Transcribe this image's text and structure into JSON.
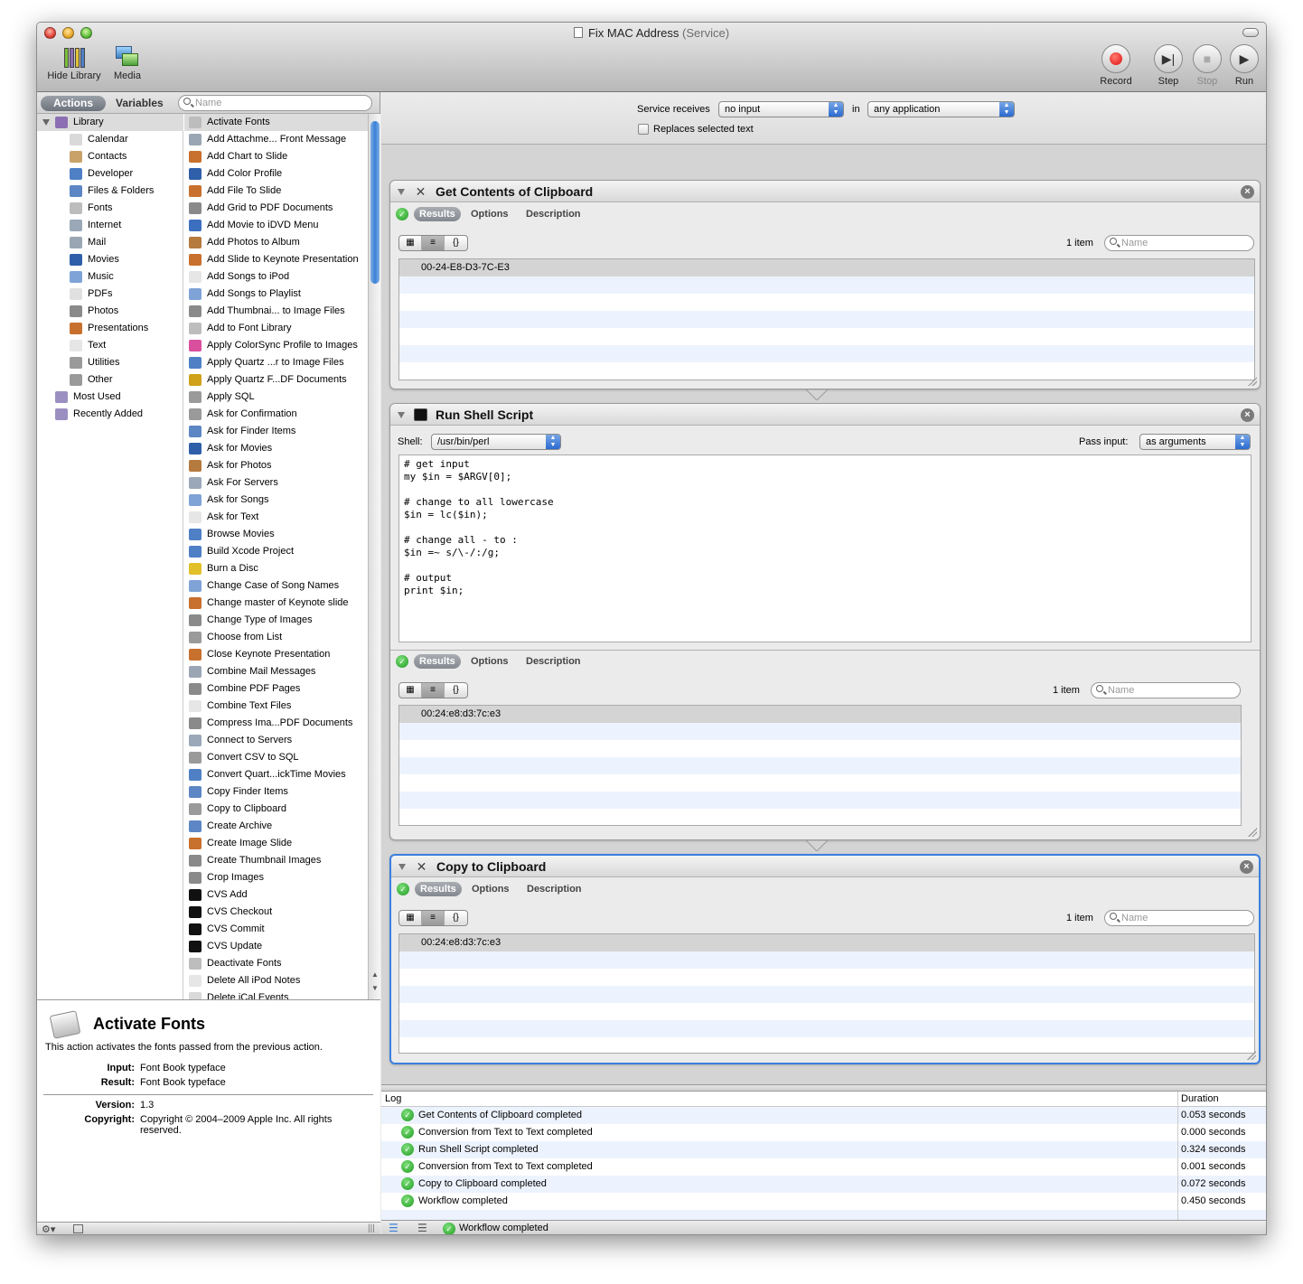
{
  "window": {
    "title": "Fix MAC Address",
    "subtitle": "(Service)"
  },
  "toolbar": {
    "hide_library": "Hide Library",
    "media": "Media",
    "record": "Record",
    "step": "Step",
    "stop": "Stop",
    "run": "Run"
  },
  "library": {
    "tab_actions": "Actions",
    "tab_variables": "Variables",
    "search_placeholder": "Name",
    "tree": [
      {
        "label": "Library",
        "icon": "library-icon",
        "color": "#8c6fb3"
      },
      {
        "label": "Calendar",
        "icon": "calendar-icon",
        "color": "#d9d9d9"
      },
      {
        "label": "Contacts",
        "icon": "contacts-icon",
        "color": "#c8a269"
      },
      {
        "label": "Developer",
        "icon": "developer-icon",
        "color": "#4f80c6"
      },
      {
        "label": "Files & Folders",
        "icon": "finder-icon",
        "color": "#5c86c4"
      },
      {
        "label": "Fonts",
        "icon": "fonts-icon",
        "color": "#bdbdbd"
      },
      {
        "label": "Internet",
        "icon": "internet-icon",
        "color": "#9aa8b8"
      },
      {
        "label": "Mail",
        "icon": "mail-icon",
        "color": "#9aa6b4"
      },
      {
        "label": "Movies",
        "icon": "movies-icon",
        "color": "#2f5fa8"
      },
      {
        "label": "Music",
        "icon": "music-icon",
        "color": "#7fa3d6"
      },
      {
        "label": "PDFs",
        "icon": "pdf-icon",
        "color": "#e0e0e0"
      },
      {
        "label": "Photos",
        "icon": "photos-icon",
        "color": "#8a8a8a"
      },
      {
        "label": "Presentations",
        "icon": "presentations-icon",
        "color": "#c8702e"
      },
      {
        "label": "Text",
        "icon": "text-icon",
        "color": "#e6e6e6"
      },
      {
        "label": "Utilities",
        "icon": "utilities-icon",
        "color": "#9a9a9a"
      },
      {
        "label": "Other",
        "icon": "other-icon",
        "color": "#9a9a9a"
      },
      {
        "label": "Most Used",
        "icon": "most-used-folder-icon",
        "color": "#9b8fc2"
      },
      {
        "label": "Recently Added",
        "icon": "recently-added-folder-icon",
        "color": "#9b8fc2"
      }
    ],
    "actions": [
      {
        "label": "Activate Fonts",
        "color": "#bdbdbd"
      },
      {
        "label": "Add Attachme... Front Message",
        "color": "#9aa6b4"
      },
      {
        "label": "Add Chart to Slide",
        "color": "#c8702e"
      },
      {
        "label": "Add Color Profile",
        "color": "#2f5fa8"
      },
      {
        "label": "Add File To Slide",
        "color": "#c8702e"
      },
      {
        "label": "Add Grid to PDF Documents",
        "color": "#8a8a8a"
      },
      {
        "label": "Add Movie to iDVD Menu",
        "color": "#3c6fbf"
      },
      {
        "label": "Add Photos to Album",
        "color": "#b57a3e"
      },
      {
        "label": "Add Slide to Keynote Presentation",
        "color": "#c8702e"
      },
      {
        "label": "Add Songs to iPod",
        "color": "#e6e6e6"
      },
      {
        "label": "Add Songs to Playlist",
        "color": "#7fa3d6"
      },
      {
        "label": "Add Thumbnai... to Image Files",
        "color": "#8a8a8a"
      },
      {
        "label": "Add to Font Library",
        "color": "#bdbdbd"
      },
      {
        "label": "Apply ColorSync Profile to Images",
        "color": "#d94f9e"
      },
      {
        "label": "Apply Quartz ...r to Image Files",
        "color": "#4f80c6"
      },
      {
        "label": "Apply Quartz F...DF Documents",
        "color": "#d0a11a"
      },
      {
        "label": "Apply SQL",
        "color": "#9a9a9a"
      },
      {
        "label": "Ask for Confirmation",
        "color": "#9a9a9a"
      },
      {
        "label": "Ask for Finder Items",
        "color": "#5c86c4"
      },
      {
        "label": "Ask for Movies",
        "color": "#2f5fa8"
      },
      {
        "label": "Ask for Photos",
        "color": "#b57a3e"
      },
      {
        "label": "Ask For Servers",
        "color": "#9aa8b8"
      },
      {
        "label": "Ask for Songs",
        "color": "#7fa3d6"
      },
      {
        "label": "Ask for Text",
        "color": "#e6e6e6"
      },
      {
        "label": "Browse Movies",
        "color": "#4f80c6"
      },
      {
        "label": "Build Xcode Project",
        "color": "#4f80c6"
      },
      {
        "label": "Burn a Disc",
        "color": "#e2c02a"
      },
      {
        "label": "Change Case of Song Names",
        "color": "#7fa3d6"
      },
      {
        "label": "Change master of Keynote slide",
        "color": "#c8702e"
      },
      {
        "label": "Change Type of Images",
        "color": "#8a8a8a"
      },
      {
        "label": "Choose from List",
        "color": "#9a9a9a"
      },
      {
        "label": "Close Keynote Presentation",
        "color": "#c8702e"
      },
      {
        "label": "Combine Mail Messages",
        "color": "#9aa6b4"
      },
      {
        "label": "Combine PDF Pages",
        "color": "#8a8a8a"
      },
      {
        "label": "Combine Text Files",
        "color": "#e6e6e6"
      },
      {
        "label": "Compress Ima...PDF Documents",
        "color": "#8a8a8a"
      },
      {
        "label": "Connect to Servers",
        "color": "#9aa8b8"
      },
      {
        "label": "Convert CSV to SQL",
        "color": "#9a9a9a"
      },
      {
        "label": "Convert Quart...ickTime Movies",
        "color": "#4f80c6"
      },
      {
        "label": "Copy Finder Items",
        "color": "#5c86c4"
      },
      {
        "label": "Copy to Clipboard",
        "color": "#9a9a9a"
      },
      {
        "label": "Create Archive",
        "color": "#5c86c4"
      },
      {
        "label": "Create Image Slide",
        "color": "#c8702e"
      },
      {
        "label": "Create Thumbnail Images",
        "color": "#8a8a8a"
      },
      {
        "label": "Crop Images",
        "color": "#8a8a8a"
      },
      {
        "label": "CVS Add",
        "color": "#111111"
      },
      {
        "label": "CVS Checkout",
        "color": "#111111"
      },
      {
        "label": "CVS Commit",
        "color": "#111111"
      },
      {
        "label": "CVS Update",
        "color": "#111111"
      },
      {
        "label": "Deactivate Fonts",
        "color": "#bdbdbd"
      },
      {
        "label": "Delete All iPod Notes",
        "color": "#e6e6e6"
      },
      {
        "label": "Delete iCal Events",
        "color": "#d9d9d9"
      }
    ]
  },
  "description": {
    "title": "Activate Fonts",
    "text": "This action activates the fonts passed from the previous action.",
    "input_label": "Input:",
    "input_value": "Font Book typeface",
    "result_label": "Result:",
    "result_value": "Font Book typeface",
    "version_label": "Version:",
    "version_value": "1.3",
    "copyright_label": "Copyright:",
    "copyright_value": "Copyright © 2004–2009 Apple Inc. All rights reserved."
  },
  "service": {
    "receives_label": "Service receives",
    "receives_value": "no input",
    "in_label": "in",
    "app_value": "any application",
    "replaces_label": "Replaces selected text",
    "replaces_checked": false
  },
  "workflow": {
    "tab_results": "Results",
    "tab_options": "Options",
    "tab_description": "Description",
    "name_placeholder": "Name",
    "actions": [
      {
        "title": "Get Contents of Clipboard",
        "count": "1 item",
        "result": "00-24-E8-D3-7C-E3"
      },
      {
        "title": "Run Shell Script",
        "shell_label": "Shell:",
        "shell_value": "/usr/bin/perl",
        "pass_label": "Pass input:",
        "pass_value": "as arguments",
        "script": "# get input\nmy $in = $ARGV[0];\n\n# change to all lowercase\n$in = lc($in);\n\n# change all - to :\n$in =~ s/\\-/:/g;\n\n# output\nprint $in;",
        "count": "1 item",
        "result": "00:24:e8:d3:7c:e3"
      },
      {
        "title": "Copy to Clipboard",
        "count": "1 item",
        "result": "00:24:e8:d3:7c:e3"
      }
    ]
  },
  "log": {
    "col_log": "Log",
    "col_duration": "Duration",
    "rows": [
      {
        "msg": "Get Contents of Clipboard completed",
        "dur": "0.053 seconds"
      },
      {
        "msg": "Conversion from Text to Text completed",
        "dur": "0.000 seconds"
      },
      {
        "msg": "Run Shell Script completed",
        "dur": "0.324 seconds"
      },
      {
        "msg": "Conversion from Text to Text completed",
        "dur": "0.001 seconds"
      },
      {
        "msg": "Copy to Clipboard completed",
        "dur": "0.072 seconds"
      },
      {
        "msg": "Workflow completed",
        "dur": "0.450 seconds"
      }
    ],
    "status": "Workflow completed"
  }
}
